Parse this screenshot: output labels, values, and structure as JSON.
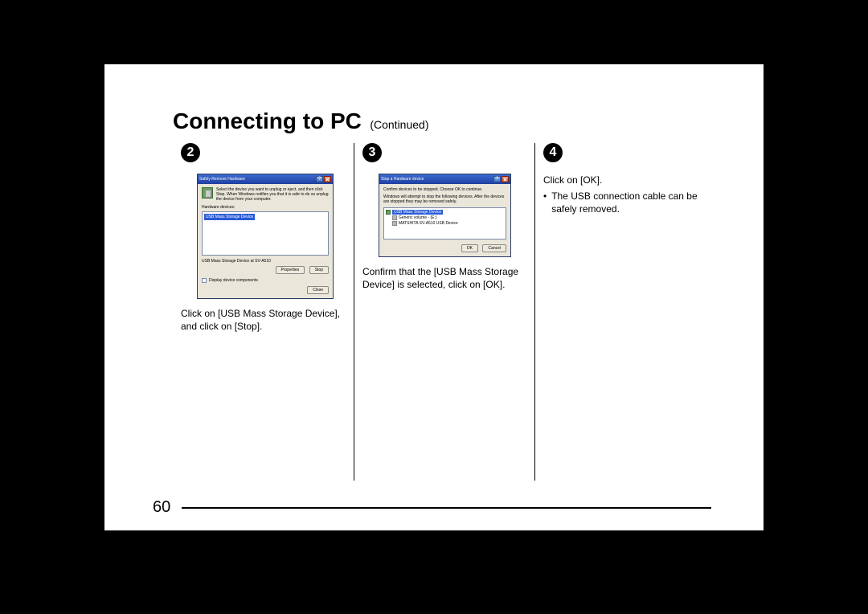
{
  "title": {
    "main": "Connecting to PC",
    "sub": "(Continued)"
  },
  "page_number": "60",
  "steps": [
    {
      "num": "2",
      "instruction": "Click on [USB Mass Storage Device], and click on [Stop].",
      "dialog": {
        "title": "Safely Remove Hardware",
        "intro": "Select the device you want to unplug or eject, and then click Stop. When Windows notifies you that it is safe to do so unplug the device from your computer.",
        "list_label": "Hardware devices:",
        "selected_item": "USB Mass Storage Device",
        "footer_label": "USB Mass Storage Device at SV-A510",
        "btn_properties": "Properties",
        "btn_stop": "Stop",
        "checkbox_label": "Display device components",
        "btn_close": "Close"
      }
    },
    {
      "num": "3",
      "instruction": "Confirm that the [USB Mass Storage Device] is selected, click on [OK].",
      "dialog": {
        "title": "Stop a Hardware device",
        "intro1": "Confirm devices to be stopped. Choose OK to continue.",
        "intro2": "Windows will attempt to stop the following devices. After the devices are stopped they may be removed safely.",
        "tree_item1": "USB Mass Storage Device",
        "tree_item2": "Generic volume - (E:)",
        "tree_item3": "MATSHITA SV-A510 USB Device",
        "btn_ok": "OK",
        "btn_cancel": "Cancel"
      }
    },
    {
      "num": "4",
      "instruction": "Click on [OK].",
      "bullet": "The USB connection cable can be safely removed."
    }
  ]
}
